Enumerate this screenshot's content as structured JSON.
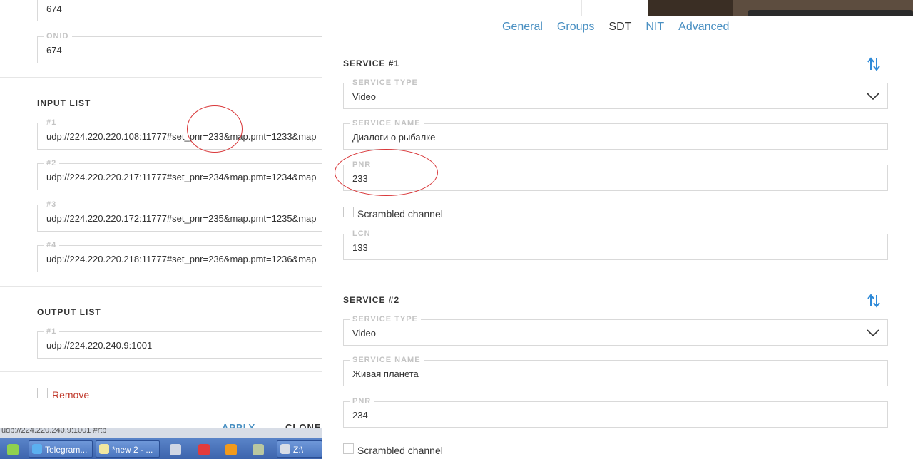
{
  "left": {
    "tsid_value": "674",
    "onid": {
      "label": "ONID",
      "value": "674"
    },
    "input_list": {
      "title": "INPUT LIST",
      "items": [
        {
          "label": "#1",
          "value": "udp://224.220.220.108:11777#set_pnr=233&map.pmt=1233&map"
        },
        {
          "label": "#2",
          "value": "udp://224.220.220.217:11777#set_pnr=234&map.pmt=1234&map"
        },
        {
          "label": "#3",
          "value": "udp://224.220.220.172:11777#set_pnr=235&map.pmt=1235&map"
        },
        {
          "label": "#4",
          "value": "udp://224.220.220.218:11777#set_pnr=236&map.pmt=1236&map"
        }
      ]
    },
    "output_list": {
      "title": "OUTPUT LIST",
      "items": [
        {
          "label": "#1",
          "value": "udp://224.220.240.9:1001"
        }
      ]
    },
    "remove_label": "Remove",
    "apply_label": "APPLY",
    "clone_label": "CLONE"
  },
  "tabs": [
    {
      "label": "General",
      "active": false
    },
    {
      "label": "Groups",
      "active": false
    },
    {
      "label": "SDT",
      "active": true
    },
    {
      "label": "NIT",
      "active": false
    },
    {
      "label": "Advanced",
      "active": false
    }
  ],
  "services": [
    {
      "title": "SERVICE #1",
      "service_type": {
        "label": "SERVICE TYPE",
        "value": "Video"
      },
      "service_name": {
        "label": "SERVICE NAME",
        "value": "Диалоги о рыбалке"
      },
      "pnr": {
        "label": "PNR",
        "value": "233"
      },
      "scrambled_label": "Scrambled channel",
      "lcn": {
        "label": "LCN",
        "value": "133"
      }
    },
    {
      "title": "SERVICE #2",
      "service_type": {
        "label": "SERVICE TYPE",
        "value": "Video"
      },
      "service_name": {
        "label": "SERVICE NAME",
        "value": "Живая планета"
      },
      "pnr": {
        "label": "PNR",
        "value": "234"
      },
      "scrambled_label": "Scrambled channel"
    }
  ],
  "taskbar": {
    "address_text": "udp://224.220.240.9:1001 #rtp",
    "buttons": [
      {
        "label": "Telegram..."
      },
      {
        "label": "*new 2 - ..."
      }
    ],
    "drive_label": "Z:\\"
  },
  "colors": {
    "accent": "#4a90c2",
    "danger": "#c0392b",
    "annotation": "#d9383a",
    "taskbar": "#3d64ad"
  }
}
